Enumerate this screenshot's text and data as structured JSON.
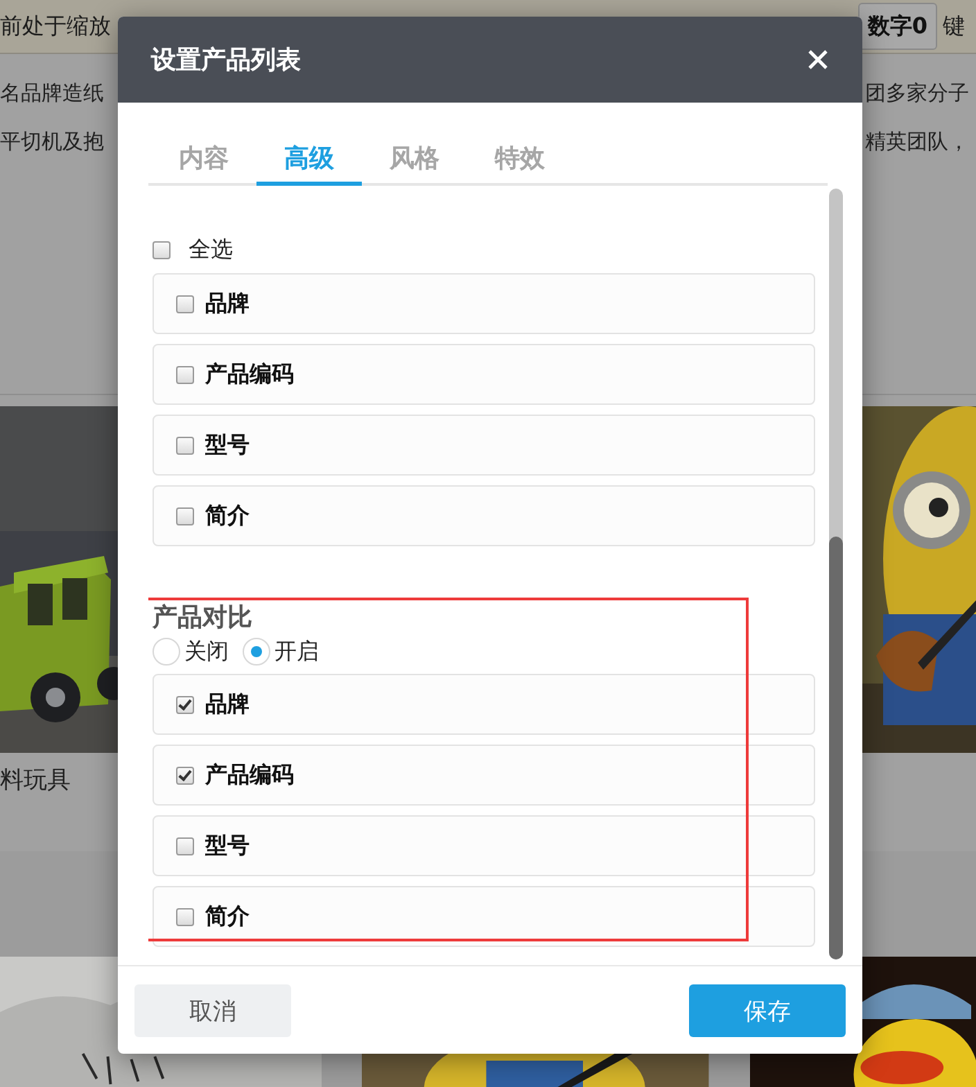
{
  "background": {
    "banner": {
      "text": "前处于缩放",
      "button": "数字0",
      "trailing": "键"
    },
    "left_column": {
      "lines": [
        "名品牌造纸",
        "平切机及抱"
      ],
      "caption": "料玩具"
    },
    "right_column": {
      "lines": [
        "团多家分子",
        "精英团队，"
      ]
    }
  },
  "dialog": {
    "title": "设置产品列表",
    "tabs": [
      {
        "label": "内容",
        "selected": false
      },
      {
        "label": "高级",
        "selected": true
      },
      {
        "label": "风格",
        "selected": false
      },
      {
        "label": "特效",
        "selected": false
      }
    ],
    "field_config": {
      "select_all": {
        "label": "全选",
        "checked": false
      },
      "fields": [
        {
          "label": "品牌",
          "checked": false
        },
        {
          "label": "产品编码",
          "checked": false
        },
        {
          "label": "型号",
          "checked": false
        },
        {
          "label": "简介",
          "checked": false
        }
      ]
    },
    "compare": {
      "title": "产品对比",
      "highlighted": true,
      "options": [
        {
          "label": "关闭",
          "selected": false
        },
        {
          "label": "开启",
          "selected": true
        }
      ],
      "fields": [
        {
          "label": "品牌",
          "checked": true
        },
        {
          "label": "产品编码",
          "checked": true
        },
        {
          "label": "型号",
          "checked": false
        },
        {
          "label": "简介",
          "checked": false
        }
      ]
    },
    "buttons": {
      "cancel": "取消",
      "save": "保存"
    }
  }
}
